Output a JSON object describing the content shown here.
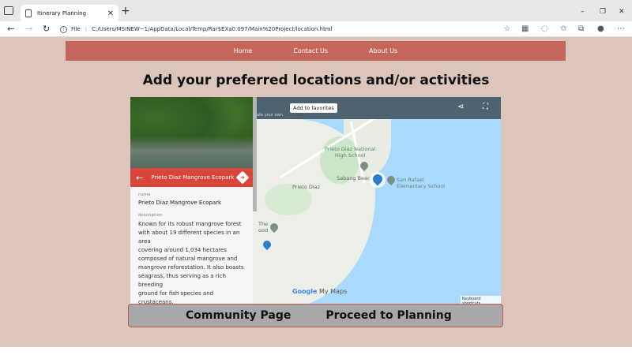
{
  "browser": {
    "tab_title": "Itinerary Planning",
    "tab_close": "✕",
    "new_tab": "+",
    "address_prefix": "File",
    "url": "C:/Users/MSINEW~1/AppData/Local/Temp/Rar$EXa0.097/Main%20Project/location.html",
    "window_controls": [
      "–",
      "❐",
      "✕"
    ]
  },
  "site_nav": {
    "items": [
      "Home",
      "Contact Us",
      "About Us"
    ]
  },
  "page": {
    "title": "Add your preferred locations and/or activities"
  },
  "place_panel": {
    "name": "Prieto Diaz Mangrove Ecopark",
    "name_label": "name",
    "name_value": "Prieto Diaz Mangrove Ecopark",
    "description_label": "description",
    "description": "Known for its robust mangrove forest\nwith about 19 different species in an area\ncovering around 1,034 hectares\ncomposed of natural mangrove and\nmangrove reforestation. It also boasts\nseagrass, thus serving as a rich breeding\nground for fish species and crustaceans.\n\nCapitalizing from this rich resource and"
  },
  "map": {
    "favorites_button": "Add to favorites",
    "subtext": "ate your own.",
    "labels": {
      "school_national": "Prieto Diaz National\nHigh School",
      "beach": "Sabang Beach",
      "san_rafael": "San Rafael\nElementary School",
      "town": "Prieto Diaz",
      "the_food": "The\nood"
    },
    "google": "Google",
    "my_maps": "My Maps",
    "keyboard_shortcuts": "Keyboard shortcuts"
  },
  "buttons": {
    "community": "Community Page",
    "planning": "Proceed to Planning"
  },
  "colors": {
    "page_bg": "#dcc6bc",
    "nav_bg": "#c4665a",
    "panel_header": "#d9453a",
    "map_water": "#aadaff",
    "button_bar": "#a8a8a8"
  }
}
